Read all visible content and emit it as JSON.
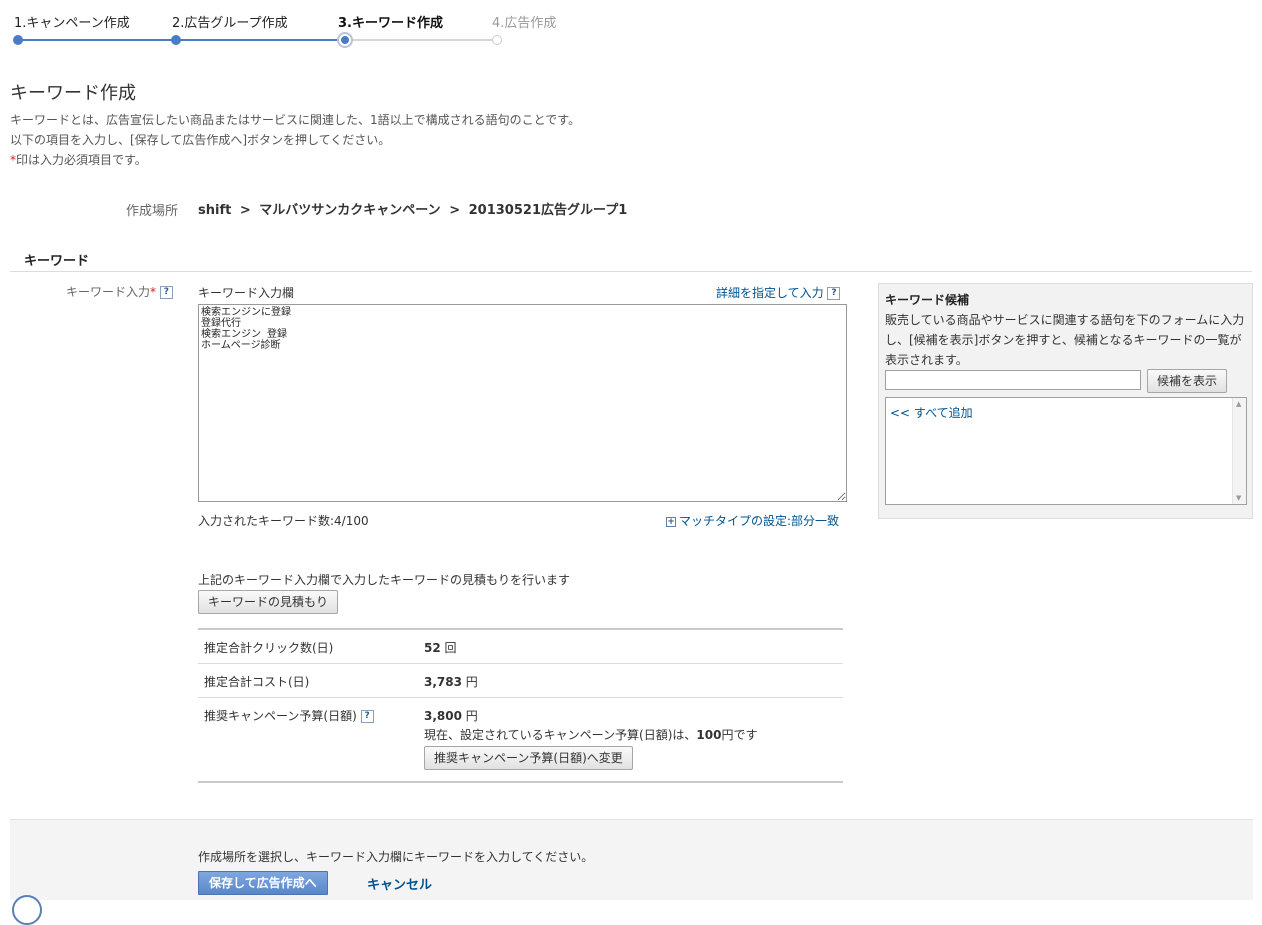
{
  "steps": [
    {
      "label": "1.キャンペーン作成",
      "state": "done"
    },
    {
      "label": "2.広告グループ作成",
      "state": "done"
    },
    {
      "label": "3.キーワード作成",
      "state": "current"
    },
    {
      "label": "4.広告作成",
      "state": "future"
    }
  ],
  "page": {
    "title": "キーワード作成",
    "intro_line1": "キーワードとは、広告宣伝したい商品またはサービスに関連した、1語以上で構成される語句のことです。",
    "intro_line2": "以下の項目を入力し、[保存して広告作成へ]ボタンを押してください。",
    "required_mark": "*",
    "intro_line3": "印は入力必須項目です。"
  },
  "location": {
    "label": "作成場所",
    "account": "shift",
    "separator": ">",
    "campaign": "マルバツサンカクキャンペーン",
    "ad_group": "20130521広告グループ1"
  },
  "keyword_section": {
    "heading": "キーワード",
    "input_label": "キーワード入力",
    "required_mark": "*",
    "help_icon": "?",
    "field_label": "キーワード入力欄",
    "detail_link": "詳細を指定して入力",
    "keywords_text": "検索エンジンに登録\n登録代行\n検索エンジン 登録\nホームページ診断",
    "count_label": "入力されたキーワード数:",
    "count_value": "4/100",
    "match_type_icon": "+",
    "match_type_link": "マッチタイプの設定:部分一致"
  },
  "estimate": {
    "description": "上記のキーワード入力欄で入力したキーワードの見積もりを行います",
    "button": "キーワードの見積もり",
    "rows": [
      {
        "label": "推定合計クリック数(日)",
        "value": "52",
        "unit": "回"
      },
      {
        "label": "推定合計コスト(日)",
        "value": "3,783",
        "unit": "円"
      },
      {
        "label": "推奨キャンペーン予算(日額)",
        "value": "3,800",
        "unit": "円"
      }
    ],
    "budget_note_prefix": "現在、設定されているキャンペーン予算(日額)は、",
    "budget_note_value": "100",
    "budget_note_suffix": "円です",
    "budget_button": "推奨キャンペーン予算(日額)へ変更"
  },
  "suggestions": {
    "title": "キーワード候補",
    "description": "販売している商品やサービスに関連する語句を下のフォームに入力し、[候補を表示]ボタンを押すと、候補となるキーワードの一覧が表示されます。",
    "input_value": "",
    "button": "候補を表示",
    "add_all": "<< すべて追加",
    "scroll_up": "▲",
    "scroll_down": "▼"
  },
  "footer": {
    "message": "作成場所を選択し、キーワード入力欄にキーワードを入力してください。",
    "save_button": "保存して広告作成へ",
    "cancel_link": "キャンセル"
  }
}
